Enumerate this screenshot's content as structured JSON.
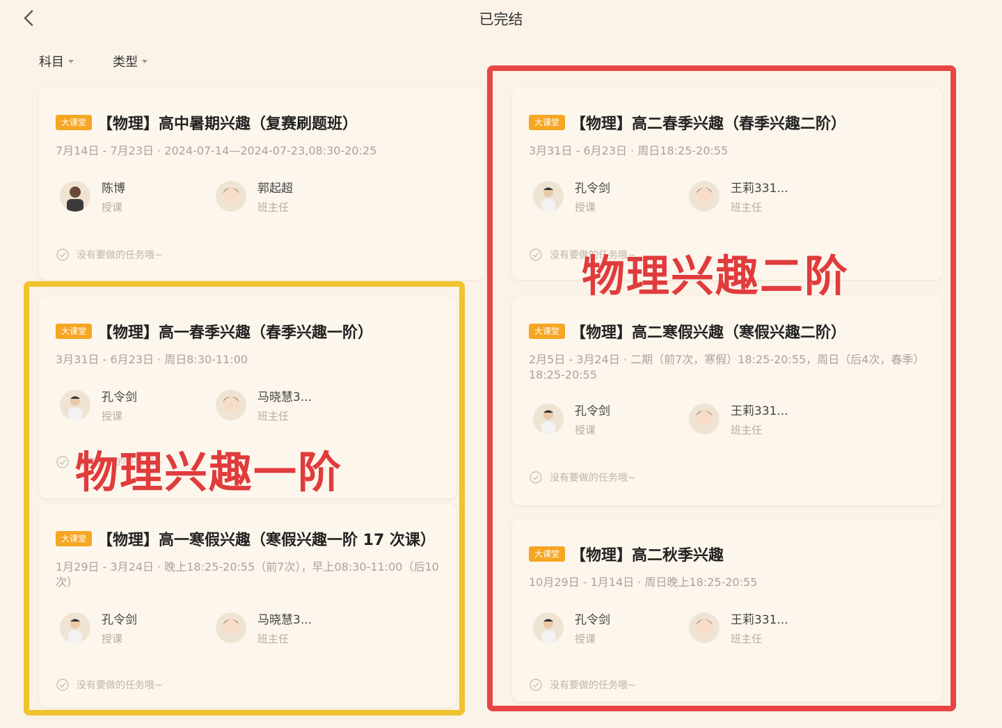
{
  "header": {
    "title": "已完结",
    "back_icon": "chevron-left-icon"
  },
  "filters": [
    {
      "label": "科目",
      "icon": "caret-down-icon"
    },
    {
      "label": "类型",
      "icon": "caret-down-icon"
    }
  ],
  "cards": [
    {
      "tag": "大课堂",
      "title": "【物理】高中暑期兴趣（复赛刷题班）",
      "schedule": "7月14日 - 7月23日 · 2024-07-14—2024-07-23,08:30-20:25",
      "teacher": {
        "name": "陈博",
        "role": "授课"
      },
      "tutor": {
        "name": "郭起超",
        "role": "班主任"
      },
      "task": "没有要做的任务哦~"
    },
    {
      "tag": "大课堂",
      "title": "【物理】高一春季兴趣（春季兴趣一阶）",
      "schedule": "3月31日 - 6月23日 · 周日8:30-11:00",
      "teacher": {
        "name": "孔令剑",
        "role": "授课"
      },
      "tutor": {
        "name": "马晓慧3...",
        "role": "班主任"
      },
      "task": "没有要做的任务哦~"
    },
    {
      "tag": "大课堂",
      "title": "【物理】高一寒假兴趣（寒假兴趣一阶 17 次课）",
      "schedule": "1月29日 - 3月24日 · 晚上18:25-20:55（前7次），早上08:30-11:00（后10次）",
      "teacher": {
        "name": "孔令剑",
        "role": "授课"
      },
      "tutor": {
        "name": "马晓慧3...",
        "role": "班主任"
      },
      "task": "没有要做的任务哦~"
    },
    {
      "tag": "大课堂",
      "title": "【物理】高二春季兴趣（春季兴趣二阶）",
      "schedule": "3月31日 - 6月23日 · 周日18:25-20:55",
      "teacher": {
        "name": "孔令剑",
        "role": "授课"
      },
      "tutor": {
        "name": "王莉331...",
        "role": "班主任"
      },
      "task": "没有要做的任务哦~"
    },
    {
      "tag": "大课堂",
      "title": "【物理】高二寒假兴趣（寒假兴趣二阶）",
      "schedule": "2月5日 - 3月24日 · 二期（前7次，寒假）18:25-20:55，周日（后4次，春季）18:25-20:55",
      "teacher": {
        "name": "孔令剑",
        "role": "授课"
      },
      "tutor": {
        "name": "王莉331...",
        "role": "班主任"
      },
      "task": "没有要做的任务哦~"
    },
    {
      "tag": "大课堂",
      "title": "【物理】高二秋季兴趣",
      "schedule": "10月29日 - 1月14日 · 周日晚上18:25-20:55",
      "teacher": {
        "name": "孔令剑",
        "role": "授课"
      },
      "tutor": {
        "name": "王莉331...",
        "role": "班主任"
      },
      "task": "没有要做的任务哦~"
    }
  ],
  "annotations": {
    "yellow_label": "物理兴趣一阶",
    "red_label": "物理兴趣二阶",
    "yellow_color": "#f0c22e",
    "red_color": "#e84545"
  }
}
